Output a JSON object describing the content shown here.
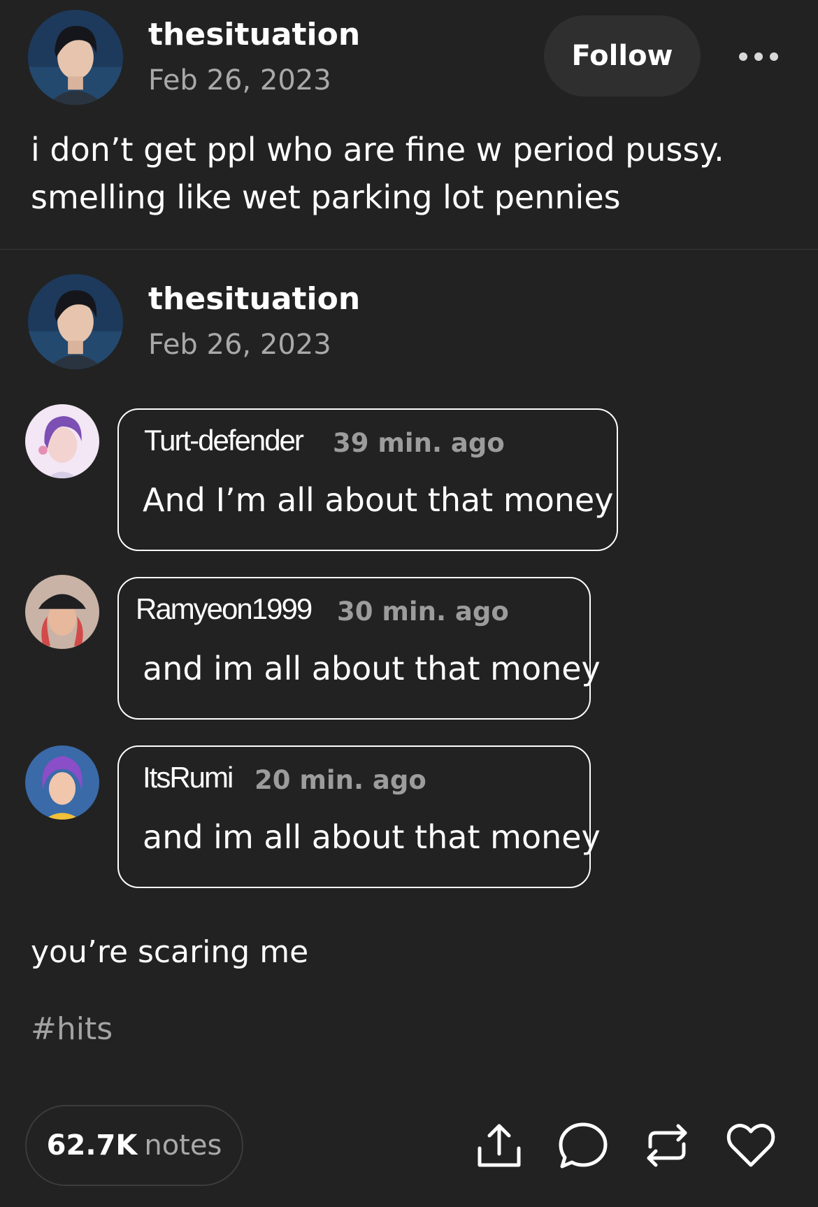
{
  "post": {
    "author": "thesituation",
    "date": "Feb 26, 2023",
    "follow_label": "Follow",
    "text_line1": "i don’t get ppl who are fine w period pussy.",
    "text_line2": "smelling like wet parking lot pennies"
  },
  "reblog": {
    "author": "thesituation",
    "date": "Feb 26, 2023",
    "comments": [
      {
        "user": "Turt-defender",
        "time": "39 min. ago",
        "text": "And I’m all about that money"
      },
      {
        "user": "Ramyeon1999",
        "time": "30 min. ago",
        "text": "and im all about that money"
      },
      {
        "user": "ItsRumi",
        "time": "20 min. ago",
        "text": "and im all about that money"
      }
    ],
    "reply": "you’re scaring me",
    "hashtag": "#hits"
  },
  "footer": {
    "notes_count": "62.7K",
    "notes_label": "notes"
  },
  "icons": {
    "more": "more-horizontal-icon",
    "share": "share-upload-icon",
    "comment": "comment-bubble-icon",
    "reblog": "reblog-icon",
    "like": "heart-icon"
  },
  "colors": {
    "background": "#222222",
    "secondary_text": "#a9a9a9",
    "button_bg": "#2f2f2f"
  }
}
